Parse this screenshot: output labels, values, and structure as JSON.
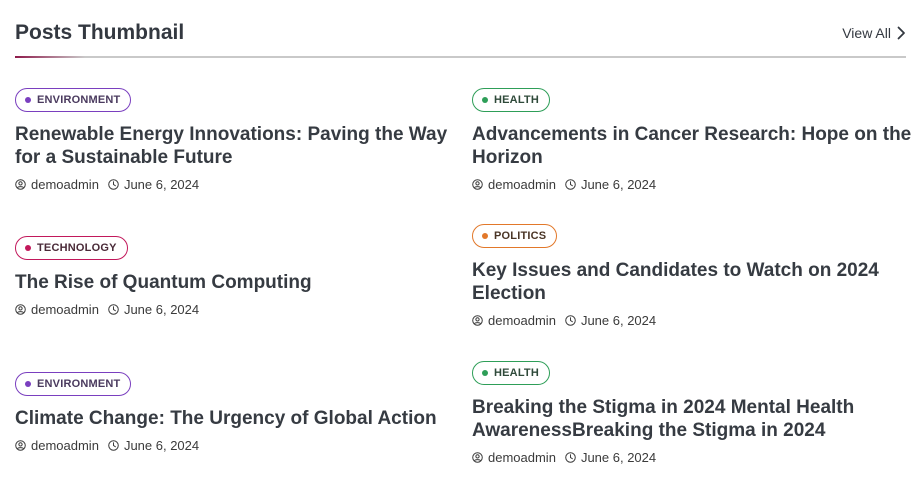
{
  "header": {
    "title": "Posts Thumbnail",
    "view_all": "View All"
  },
  "colors": {
    "environment": "#7a3fbf",
    "technology": "#c2185b",
    "health": "#2e9e58",
    "politics": "#e2782a"
  },
  "posts": [
    {
      "category": "ENVIRONMENT",
      "title": "Renewable Energy Innovations: Paving the Way for a Sustainable Future",
      "author": "demoadmin",
      "date": "June 6, 2024"
    },
    {
      "category": "HEALTH",
      "title": "Advancements in Cancer Research: Hope on the Horizon",
      "author": "demoadmin",
      "date": "June 6, 2024"
    },
    {
      "category": "TECHNOLOGY",
      "title": "The Rise of Quantum Computing",
      "author": "demoadmin",
      "date": "June 6, 2024"
    },
    {
      "category": "POLITICS",
      "title": "Key Issues and Candidates to Watch on 2024 Election",
      "author": "demoadmin",
      "date": "June 6, 2024"
    },
    {
      "category": "ENVIRONMENT",
      "title": "Climate Change: The Urgency of Global Action",
      "author": "demoadmin",
      "date": "June 6, 2024"
    },
    {
      "category": "HEALTH",
      "title": "Breaking the Stigma in 2024 Mental Health AwarenessBreaking the Stigma in 2024",
      "author": "demoadmin",
      "date": "June 6, 2024"
    }
  ]
}
